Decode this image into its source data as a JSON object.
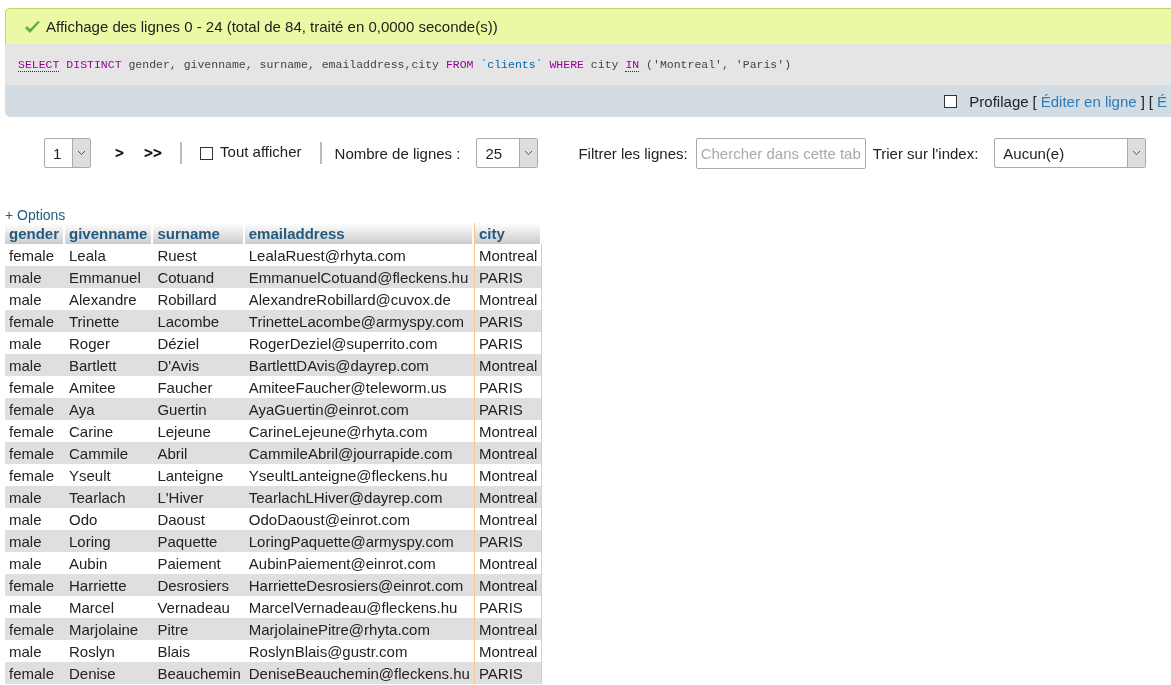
{
  "message": {
    "kind": "success",
    "text": "Affichage des lignes 0 - 24 (total de 84, traité en 0,0000 seconde(s))"
  },
  "sql": [
    {
      "kind": "keyword",
      "text": "SELECT",
      "linked": true
    },
    {
      "kind": "keyword",
      "text": " DISTINCT",
      "linked": false
    },
    {
      "kind": "plain",
      "text": " gender, givenname, surname, emailaddress,city ",
      "linked": false
    },
    {
      "kind": "keyword",
      "text": "FROM",
      "linked": false
    },
    {
      "kind": "identifier",
      "text": " `clients`",
      "linked": false
    },
    {
      "kind": "keyword",
      "text": " WHERE",
      "linked": false
    },
    {
      "kind": "plain",
      "text": " city ",
      "linked": false
    },
    {
      "kind": "keyword",
      "text": "IN",
      "linked": true
    },
    {
      "kind": "plain",
      "text": " (",
      "linked": false
    },
    {
      "kind": "string",
      "text": "'Montreal'",
      "linked": false
    },
    {
      "kind": "plain",
      "text": ", ",
      "linked": false
    },
    {
      "kind": "string",
      "text": "'Paris'",
      "linked": false
    },
    {
      "kind": "plain",
      "text": ")",
      "linked": false
    }
  ],
  "query_tools": {
    "profiling": {
      "label": "Profilage",
      "checked": false
    },
    "items": [
      {
        "kind": "text",
        "text": "["
      },
      {
        "kind": "link",
        "text": "Éditer en ligne"
      },
      {
        "kind": "text",
        "text": "]"
      },
      {
        "kind": "text",
        "text": "["
      },
      {
        "kind": "link",
        "text": "É"
      }
    ]
  },
  "navigation": {
    "page": "1",
    "next": ">",
    "last": ">>",
    "show_all": {
      "label": "Tout afficher",
      "checked": false
    },
    "rows_label": "Nombre de lignes :",
    "rows_value": "25",
    "filter_label": "Filtrer les lignes:",
    "filter_placeholder": "Chercher dans cette tab",
    "sort_label": "Trier sur l'index:",
    "sort_value": "Aucun(e)"
  },
  "options_link": "+ Options",
  "table": {
    "columns": [
      {
        "label": "gender",
        "marked": false
      },
      {
        "label": "givenname",
        "marked": false
      },
      {
        "label": "surname",
        "marked": false
      },
      {
        "label": "emailaddress",
        "marked": false
      },
      {
        "label": "city",
        "marked": true
      }
    ],
    "rows": [
      [
        "female",
        "Leala",
        "Ruest",
        "LealaRuest@rhyta.com",
        "Montreal"
      ],
      [
        "male",
        "Emmanuel",
        "Cotuand",
        "EmmanuelCotuand@fleckens.hu",
        "PARIS"
      ],
      [
        "male",
        "Alexandre",
        "Robillard",
        "AlexandreRobillard@cuvox.de",
        "Montreal"
      ],
      [
        "female",
        "Trinette",
        "Lacombe",
        "TrinetteLacombe@armyspy.com",
        "PARIS"
      ],
      [
        "male",
        "Roger",
        "Déziel",
        "RogerDeziel@superrito.com",
        "PARIS"
      ],
      [
        "male",
        "Bartlett",
        "D'Avis",
        "BartlettDAvis@dayrep.com",
        "Montreal"
      ],
      [
        "female",
        "Amitee",
        "Faucher",
        "AmiteeFaucher@teleworm.us",
        "PARIS"
      ],
      [
        "female",
        "Aya",
        "Guertin",
        "AyaGuertin@einrot.com",
        "PARIS"
      ],
      [
        "female",
        "Carine",
        "Lejeune",
        "CarineLejeune@rhyta.com",
        "Montreal"
      ],
      [
        "female",
        "Cammile",
        "Abril",
        "CammileAbril@jourrapide.com",
        "Montreal"
      ],
      [
        "female",
        "Yseult",
        "Lanteigne",
        "YseultLanteigne@fleckens.hu",
        "Montreal"
      ],
      [
        "male",
        "Tearlach",
        "L'Hiver",
        "TearlachLHiver@dayrep.com",
        "Montreal"
      ],
      [
        "male",
        "Odo",
        "Daoust",
        "OdoDaoust@einrot.com",
        "Montreal"
      ],
      [
        "male",
        "Loring",
        "Paquette",
        "LoringPaquette@armyspy.com",
        "PARIS"
      ],
      [
        "male",
        "Aubin",
        "Paiement",
        "AubinPaiement@einrot.com",
        "Montreal"
      ],
      [
        "female",
        "Harriette",
        "Desrosiers",
        "HarrietteDesrosiers@einrot.com",
        "Montreal"
      ],
      [
        "male",
        "Marcel",
        "Vernadeau",
        "MarcelVernadeau@fleckens.hu",
        "PARIS"
      ],
      [
        "female",
        "Marjolaine",
        "Pitre",
        "MarjolainePitre@rhyta.com",
        "Montreal"
      ],
      [
        "male",
        "Roslyn",
        "Blais",
        "RoslynBlais@gustr.com",
        "Montreal"
      ],
      [
        "female",
        "Denise",
        "Beauchemin",
        "DeniseBeauchemin@fleckens.hu",
        "PARIS"
      ]
    ]
  }
}
